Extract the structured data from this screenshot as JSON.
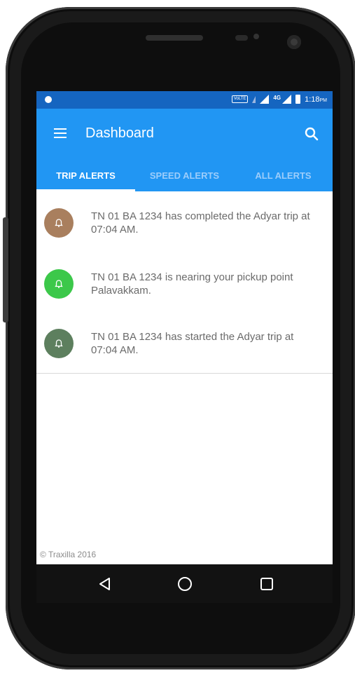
{
  "status_bar": {
    "volte": "VoLTE",
    "network": "4G",
    "time": "1:18",
    "ampm": "PM"
  },
  "app_bar": {
    "title": "Dashboard",
    "menu_icon": "menu-icon",
    "search_icon": "search-icon"
  },
  "tabs": [
    {
      "label": "TRIP ALERTS",
      "active": true
    },
    {
      "label": "SPEED ALERTS",
      "active": false
    },
    {
      "label": "ALL ALERTS",
      "active": false
    }
  ],
  "alerts": [
    {
      "text": "TN 01 BA 1234 has completed the Adyar trip at 07:04 AM.",
      "icon": "bell-icon",
      "color": "#a97f5e"
    },
    {
      "text": "TN 01 BA 1234 is nearing your pickup point Palavakkam.",
      "icon": "bell-icon",
      "color": "#3cc84a"
    },
    {
      "text": "TN 01 BA 1234 has started the Adyar trip at 07:04 AM.",
      "icon": "bell-icon",
      "color": "#5d7f5e"
    }
  ],
  "footer": {
    "copyright": "© Traxilla 2016"
  },
  "nav_bar": {
    "back_icon": "back-icon",
    "home_icon": "home-icon",
    "recents_icon": "recents-icon"
  },
  "colors": {
    "status_bar": "#1565c0",
    "app_bar": "#2196f3",
    "tab_inactive": "#9ccdfb"
  }
}
